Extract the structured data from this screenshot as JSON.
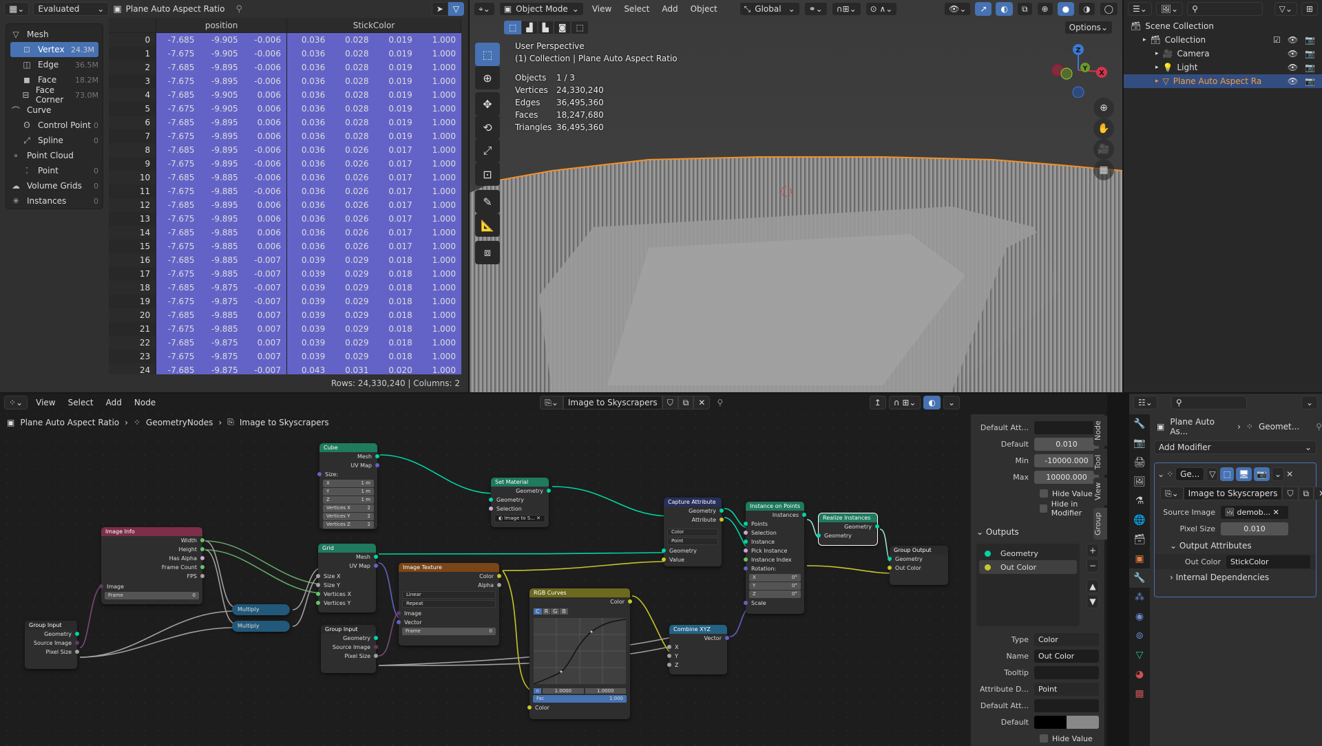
{
  "spreadsheet": {
    "display_mode": "Evaluated",
    "object": "Plane Auto Aspect Ratio",
    "domains": [
      {
        "label": "Mesh",
        "count": "",
        "level": 0,
        "icon": "mesh-icon"
      },
      {
        "label": "Vertex",
        "count": "24.3M",
        "level": 1,
        "icon": "vertex-icon",
        "selected": true
      },
      {
        "label": "Edge",
        "count": "36.5M",
        "level": 1,
        "icon": "edge-icon"
      },
      {
        "label": "Face",
        "count": "18.2M",
        "level": 1,
        "icon": "face-icon"
      },
      {
        "label": "Face Corner",
        "count": "73.0M",
        "level": 1,
        "icon": "face-corner-icon"
      },
      {
        "label": "Curve",
        "count": "",
        "level": 0,
        "icon": "curve-icon"
      },
      {
        "label": "Control Point",
        "count": "0",
        "level": 1,
        "icon": "control-point-icon"
      },
      {
        "label": "Spline",
        "count": "0",
        "level": 1,
        "icon": "spline-icon"
      },
      {
        "label": "Point Cloud",
        "count": "",
        "level": 0,
        "icon": "point-cloud-icon"
      },
      {
        "label": "Point",
        "count": "0",
        "level": 1,
        "icon": "point-icon"
      },
      {
        "label": "Volume Grids",
        "count": "0",
        "level": 0,
        "icon": "volume-icon"
      },
      {
        "label": "Instances",
        "count": "0",
        "level": 0,
        "icon": "instances-icon"
      }
    ],
    "columns": [
      "position",
      "StickColor"
    ],
    "rows": [
      [
        "0",
        "-7.685",
        "-9.905",
        "-0.006",
        "0.036",
        "0.028",
        "0.019",
        "1.000"
      ],
      [
        "1",
        "-7.675",
        "-9.905",
        "-0.006",
        "0.036",
        "0.028",
        "0.019",
        "1.000"
      ],
      [
        "2",
        "-7.685",
        "-9.895",
        "-0.006",
        "0.036",
        "0.028",
        "0.019",
        "1.000"
      ],
      [
        "3",
        "-7.675",
        "-9.895",
        "-0.006",
        "0.036",
        "0.028",
        "0.019",
        "1.000"
      ],
      [
        "4",
        "-7.685",
        "-9.905",
        "0.006",
        "0.036",
        "0.028",
        "0.019",
        "1.000"
      ],
      [
        "5",
        "-7.675",
        "-9.905",
        "0.006",
        "0.036",
        "0.028",
        "0.019",
        "1.000"
      ],
      [
        "6",
        "-7.685",
        "-9.895",
        "0.006",
        "0.036",
        "0.028",
        "0.019",
        "1.000"
      ],
      [
        "7",
        "-7.675",
        "-9.895",
        "0.006",
        "0.036",
        "0.028",
        "0.019",
        "1.000"
      ],
      [
        "8",
        "-7.685",
        "-9.895",
        "-0.006",
        "0.036",
        "0.026",
        "0.017",
        "1.000"
      ],
      [
        "9",
        "-7.675",
        "-9.895",
        "-0.006",
        "0.036",
        "0.026",
        "0.017",
        "1.000"
      ],
      [
        "10",
        "-7.685",
        "-9.885",
        "-0.006",
        "0.036",
        "0.026",
        "0.017",
        "1.000"
      ],
      [
        "11",
        "-7.675",
        "-9.885",
        "-0.006",
        "0.036",
        "0.026",
        "0.017",
        "1.000"
      ],
      [
        "12",
        "-7.685",
        "-9.895",
        "0.006",
        "0.036",
        "0.026",
        "0.017",
        "1.000"
      ],
      [
        "13",
        "-7.675",
        "-9.895",
        "0.006",
        "0.036",
        "0.026",
        "0.017",
        "1.000"
      ],
      [
        "14",
        "-7.685",
        "-9.885",
        "0.006",
        "0.036",
        "0.026",
        "0.017",
        "1.000"
      ],
      [
        "15",
        "-7.675",
        "-9.885",
        "0.006",
        "0.036",
        "0.026",
        "0.017",
        "1.000"
      ],
      [
        "16",
        "-7.685",
        "-9.885",
        "-0.007",
        "0.039",
        "0.029",
        "0.018",
        "1.000"
      ],
      [
        "17",
        "-7.675",
        "-9.885",
        "-0.007",
        "0.039",
        "0.029",
        "0.018",
        "1.000"
      ],
      [
        "18",
        "-7.685",
        "-9.875",
        "-0.007",
        "0.039",
        "0.029",
        "0.018",
        "1.000"
      ],
      [
        "19",
        "-7.675",
        "-9.875",
        "-0.007",
        "0.039",
        "0.029",
        "0.018",
        "1.000"
      ],
      [
        "20",
        "-7.685",
        "-9.885",
        "0.007",
        "0.039",
        "0.029",
        "0.018",
        "1.000"
      ],
      [
        "21",
        "-7.675",
        "-9.885",
        "0.007",
        "0.039",
        "0.029",
        "0.018",
        "1.000"
      ],
      [
        "22",
        "-7.685",
        "-9.875",
        "0.007",
        "0.039",
        "0.029",
        "0.018",
        "1.000"
      ],
      [
        "23",
        "-7.675",
        "-9.875",
        "0.007",
        "0.039",
        "0.029",
        "0.018",
        "1.000"
      ],
      [
        "24",
        "-7.685",
        "-9.875",
        "-0.007",
        "0.043",
        "0.031",
        "0.020",
        "1.000"
      ]
    ],
    "footer": "Rows: 24,330,240   |   Columns: 2"
  },
  "viewport": {
    "mode": "Object Mode",
    "menus": [
      "View",
      "Select",
      "Add",
      "Object"
    ],
    "orientation": "Global",
    "options": "Options",
    "view_name": "User Perspective",
    "collection_line": "(1) Collection | Plane Auto Aspect Ratio",
    "stats": [
      {
        "label": "Objects",
        "value": "1 / 3"
      },
      {
        "label": "Vertices",
        "value": "24,330,240"
      },
      {
        "label": "Edges",
        "value": "36,495,360"
      },
      {
        "label": "Faces",
        "value": "18,247,680"
      },
      {
        "label": "Triangles",
        "value": "36,495,360"
      }
    ],
    "gizmo": {
      "x": "X",
      "y": "Y",
      "z": "Z"
    }
  },
  "outliner": {
    "items": [
      {
        "label": "Scene Collection",
        "level": 0
      },
      {
        "label": "Collection",
        "level": 1
      },
      {
        "label": "Camera",
        "level": 2
      },
      {
        "label": "Light",
        "level": 2
      },
      {
        "label": "Plane Auto Aspect Ra",
        "level": 2,
        "selected": true
      }
    ]
  },
  "node_editor": {
    "menus": [
      "View",
      "Select",
      "Add",
      "Node"
    ],
    "node_group": "Image to Skyscrapers",
    "breadcrumb": [
      "Plane Auto Aspect Ratio",
      "GeometryNodes",
      "Image to Skyscrapers"
    ],
    "nodes": {
      "cube": {
        "title": "Cube",
        "outputs": [
          "Mesh",
          "UV Map"
        ],
        "size_label": "Size:",
        "x": "1 m",
        "y": "1 m",
        "z": "1 m",
        "vx": "2",
        "vy": "2",
        "vz": "2"
      },
      "grid": {
        "title": "Grid",
        "outputs": [
          "Mesh",
          "UV Map"
        ],
        "inputs": [
          "Size X",
          "Size Y",
          "Vertices X",
          "Vertices Y"
        ]
      },
      "image_info": {
        "title": "Image Info",
        "outputs": [
          "Width",
          "Height",
          "Has Alpha",
          "Frame Count",
          "FPS"
        ],
        "inputs": [
          "Image"
        ],
        "frame": "0"
      },
      "multiply1": {
        "title": "Multiply"
      },
      "multiply2": {
        "title": "Multiply"
      },
      "group_input1": {
        "title": "Group Input",
        "outputs": [
          "Geometry",
          "Source Image",
          "Pixel Size"
        ]
      },
      "group_input2": {
        "title": "Group Input",
        "outputs": [
          "Geometry",
          "Source Image",
          "Pixel Size"
        ]
      },
      "set_material": {
        "title": "Set Material",
        "outputs": [
          "Geometry"
        ],
        "inputs": [
          "Geometry",
          "Selection"
        ],
        "material": "Image to S..."
      },
      "image_texture": {
        "title": "Image Texture",
        "outputs": [
          "Color",
          "Alpha"
        ],
        "interp": "Linear",
        "ext": "Repeat",
        "inputs": [
          "Image",
          "Vector"
        ],
        "frame": "0"
      },
      "rgb_curves": {
        "title": "RGB Curves",
        "outputs": [
          "Color"
        ],
        "channels": [
          "C",
          "R",
          "G",
          "B"
        ],
        "v1": "1.0000",
        "v2": "1.0000",
        "fac": "1.000",
        "inputs": [
          "Color"
        ]
      },
      "capture": {
        "title": "Capture Attribute",
        "outputs": [
          "Geometry",
          "Attribute"
        ],
        "type": "Color",
        "domain": "Point",
        "inputs": [
          "Geometry",
          "Value"
        ]
      },
      "combine": {
        "title": "Combine XYZ",
        "outputs": [
          "Vector"
        ],
        "inputs": [
          "X",
          "Y",
          "Z"
        ]
      },
      "iop": {
        "title": "Instance on Points",
        "outputs": [
          "Instances"
        ],
        "inputs": [
          "Points",
          "Selection",
          "Instance",
          "Pick Instance",
          "Instance Index",
          "Rotation:"
        ],
        "rx": "0°",
        "ry": "0°",
        "rz": "0°",
        "scale": "Scale"
      },
      "realize": {
        "title": "Realize Instances",
        "outputs": [
          "Geometry"
        ],
        "inputs": [
          "Geometry"
        ]
      },
      "group_output": {
        "title": "Group Output",
        "inputs": [
          "Geometry",
          "Out Color"
        ]
      }
    }
  },
  "sidebar": {
    "tabs": [
      "Node",
      "Tool",
      "View",
      "Group"
    ],
    "top": {
      "default_att": "Default Att...",
      "default": "0.010",
      "min": "-10000.000",
      "max": "10000.000",
      "hide_value": "Hide Value",
      "hide_in_modifier": "Hide in Modifier"
    },
    "outputs_title": "Outputs",
    "outputs": [
      {
        "label": "Geometry",
        "color": "#00d6a3"
      },
      {
        "label": "Out Color",
        "color": "#c7c729"
      }
    ],
    "type": "Color",
    "name": "Out Color",
    "tooltip": "",
    "attr_domain": "Point",
    "labels": {
      "type": "Type",
      "name": "Name",
      "tooltip": "Tooltip",
      "attr_domain": "Attribute D...",
      "default_att": "Default Att...",
      "default": "Default",
      "min": "Min",
      "max": "Max"
    },
    "hide_value": "Hide Value"
  },
  "properties": {
    "breadcrumb": [
      "Plane Auto As...",
      "Geomet..."
    ],
    "add_modifier": "Add Modifier",
    "modifier_name": "Ge...",
    "node_group": "Image to Skyscrapers",
    "source_image_label": "Source Image",
    "source_image": "demob...",
    "pixel_size_label": "Pixel Size",
    "pixel_size": "0.010",
    "output_attributes": "Output Attributes",
    "out_color_label": "Out Color",
    "out_color": "StickColor",
    "internal_deps": "Internal Dependencies"
  }
}
